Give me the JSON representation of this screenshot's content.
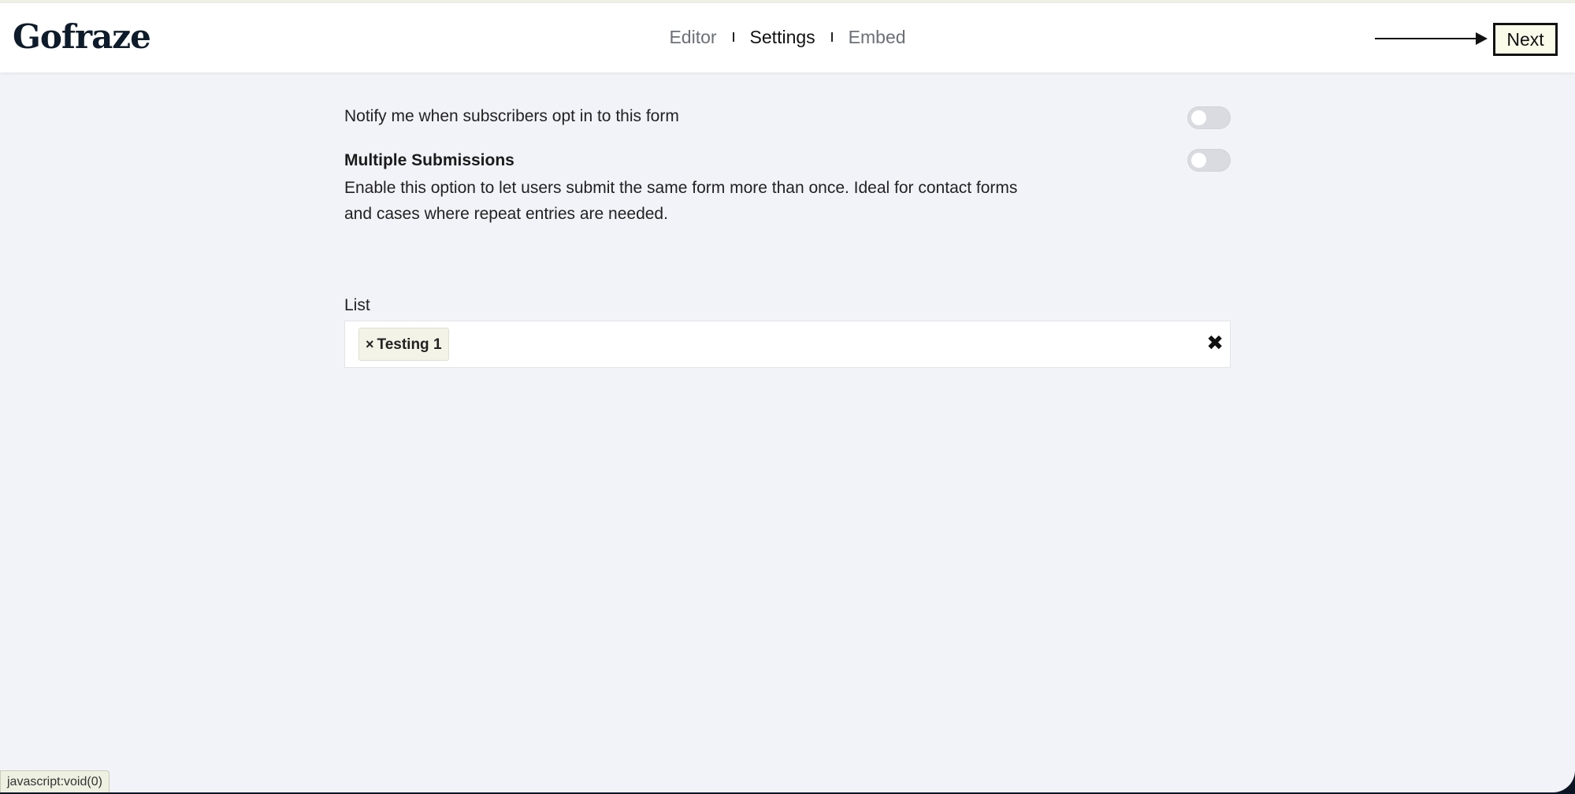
{
  "header": {
    "logo": "Gofraze",
    "nav": [
      {
        "label": "Editor"
      },
      {
        "label": "Settings"
      },
      {
        "label": "Embed"
      }
    ],
    "next_label": "Next"
  },
  "settings": {
    "notify_label": "Notify me when subscribers opt in to this form",
    "notify_enabled": false,
    "multiple_title": "Multiple Submissions",
    "multiple_desc_line1": "Enable this option to let users submit the same form more than once. Ideal for contact forms",
    "multiple_desc_line2": "and cases where repeat entries are needed.",
    "multiple_enabled": false
  },
  "list": {
    "label": "List",
    "tags": [
      {
        "remove_glyph": "×",
        "label": "Testing 1"
      }
    ],
    "clear_glyph": "✖"
  },
  "status_bar": {
    "text": "javascript:void(0)"
  }
}
